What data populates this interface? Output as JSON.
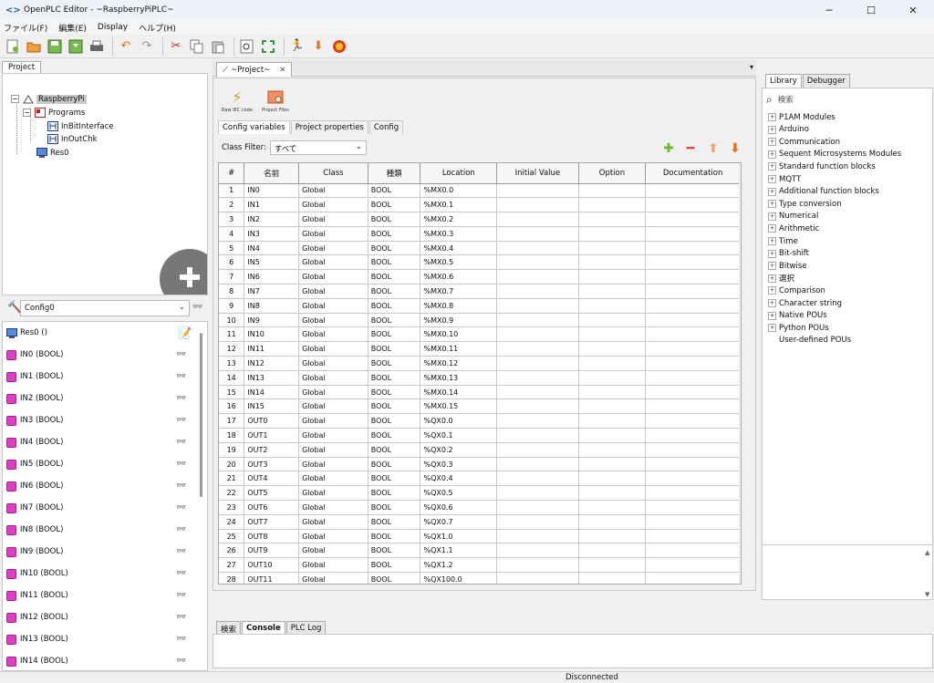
{
  "window": {
    "title": "OpenPLC Editor - ~RaspberryPiPLC~",
    "minimize": "─",
    "maximize": "☐",
    "close": "✕"
  },
  "menu": [
    "ファイル(F)",
    "編集(E)",
    "Display",
    "ヘルプ(H)"
  ],
  "left_tabs": {
    "project": "Project"
  },
  "tree": {
    "root": "RaspberryPi",
    "programs": "Programs",
    "pou1": "InBitInterface",
    "pou2": "InOutChk",
    "res": "Res0"
  },
  "config": {
    "selected": "Config0"
  },
  "instances": {
    "res": "Res0 ()",
    "items": [
      "IN0 (BOOL)",
      "IN1 (BOOL)",
      "IN2 (BOOL)",
      "IN3 (BOOL)",
      "IN4 (BOOL)",
      "IN5 (BOOL)",
      "IN6 (BOOL)",
      "IN7 (BOOL)",
      "IN8 (BOOL)",
      "IN9 (BOOL)",
      "IN10 (BOOL)",
      "IN11 (BOOL)",
      "IN12 (BOOL)",
      "IN13 (BOOL)",
      "IN14 (BOOL)"
    ]
  },
  "editor_tab": {
    "label": "~Project~",
    "close": "✕"
  },
  "tools": {
    "raw_iec": "Raw IEC code",
    "project_files": "Project Files"
  },
  "subtabs": [
    "Config variables",
    "Project properties",
    "Config"
  ],
  "filter": {
    "label": "Class Filter:",
    "value": "すべて"
  },
  "table": {
    "headers": [
      "#",
      "名前",
      "Class",
      "種類",
      "Location",
      "Initial Value",
      "Option",
      "Documentation"
    ],
    "rows": [
      [
        "1",
        "IN0",
        "Global",
        "BOOL",
        "%MX0.0"
      ],
      [
        "2",
        "IN1",
        "Global",
        "BOOL",
        "%MX0.1"
      ],
      [
        "3",
        "IN2",
        "Global",
        "BOOL",
        "%MX0.2"
      ],
      [
        "4",
        "IN3",
        "Global",
        "BOOL",
        "%MX0.3"
      ],
      [
        "5",
        "IN4",
        "Global",
        "BOOL",
        "%MX0.4"
      ],
      [
        "6",
        "IN5",
        "Global",
        "BOOL",
        "%MX0.5"
      ],
      [
        "7",
        "IN6",
        "Global",
        "BOOL",
        "%MX0.6"
      ],
      [
        "8",
        "IN7",
        "Global",
        "BOOL",
        "%MX0.7"
      ],
      [
        "9",
        "IN8",
        "Global",
        "BOOL",
        "%MX0.8"
      ],
      [
        "10",
        "IN9",
        "Global",
        "BOOL",
        "%MX0.9"
      ],
      [
        "11",
        "IN10",
        "Global",
        "BOOL",
        "%MX0.10"
      ],
      [
        "12",
        "IN11",
        "Global",
        "BOOL",
        "%MX0.11"
      ],
      [
        "13",
        "IN12",
        "Global",
        "BOOL",
        "%MX0.12"
      ],
      [
        "14",
        "IN13",
        "Global",
        "BOOL",
        "%MX0.13"
      ],
      [
        "15",
        "IN14",
        "Global",
        "BOOL",
        "%MX0.14"
      ],
      [
        "16",
        "IN15",
        "Global",
        "BOOL",
        "%MX0.15"
      ],
      [
        "17",
        "OUT0",
        "Global",
        "BOOL",
        "%QX0.0"
      ],
      [
        "18",
        "OUT1",
        "Global",
        "BOOL",
        "%QX0.1"
      ],
      [
        "19",
        "OUT2",
        "Global",
        "BOOL",
        "%QX0.2"
      ],
      [
        "20",
        "OUT3",
        "Global",
        "BOOL",
        "%QX0.3"
      ],
      [
        "21",
        "OUT4",
        "Global",
        "BOOL",
        "%QX0.4"
      ],
      [
        "22",
        "OUT5",
        "Global",
        "BOOL",
        "%QX0.5"
      ],
      [
        "23",
        "OUT6",
        "Global",
        "BOOL",
        "%QX0.6"
      ],
      [
        "24",
        "OUT7",
        "Global",
        "BOOL",
        "%QX0.7"
      ],
      [
        "25",
        "OUT8",
        "Global",
        "BOOL",
        "%QX1.0"
      ],
      [
        "26",
        "OUT9",
        "Global",
        "BOOL",
        "%QX1.1"
      ],
      [
        "27",
        "OUT10",
        "Global",
        "BOOL",
        "%QX1.2"
      ],
      [
        "28",
        "OUT11",
        "Global",
        "BOOL",
        "%QX100.0"
      ]
    ]
  },
  "right_tabs": [
    "Library",
    "Debugger"
  ],
  "library": {
    "search_placeholder": "検索",
    "items": [
      "P1AM Modules",
      "Arduino",
      "Communication",
      "Sequent Microsystems Modules",
      "Standard function blocks",
      "MQTT",
      "Additional function blocks",
      "Type conversion",
      "Numerical",
      "Arithmetic",
      "Time",
      "Bit-shift",
      "Bitwise",
      "選択",
      "Comparison",
      "Character string",
      "Native POUs",
      "Python POUs",
      "User-defined POUs"
    ]
  },
  "bottom_tabs": [
    "検索",
    "Console",
    "PLC Log"
  ],
  "status": {
    "text": "Disconnected"
  },
  "colors": {
    "accent": "#1f5fa8",
    "add": "#6dbb2a",
    "remove": "#e04040",
    "up": "#f0a870",
    "down": "#e87020"
  }
}
